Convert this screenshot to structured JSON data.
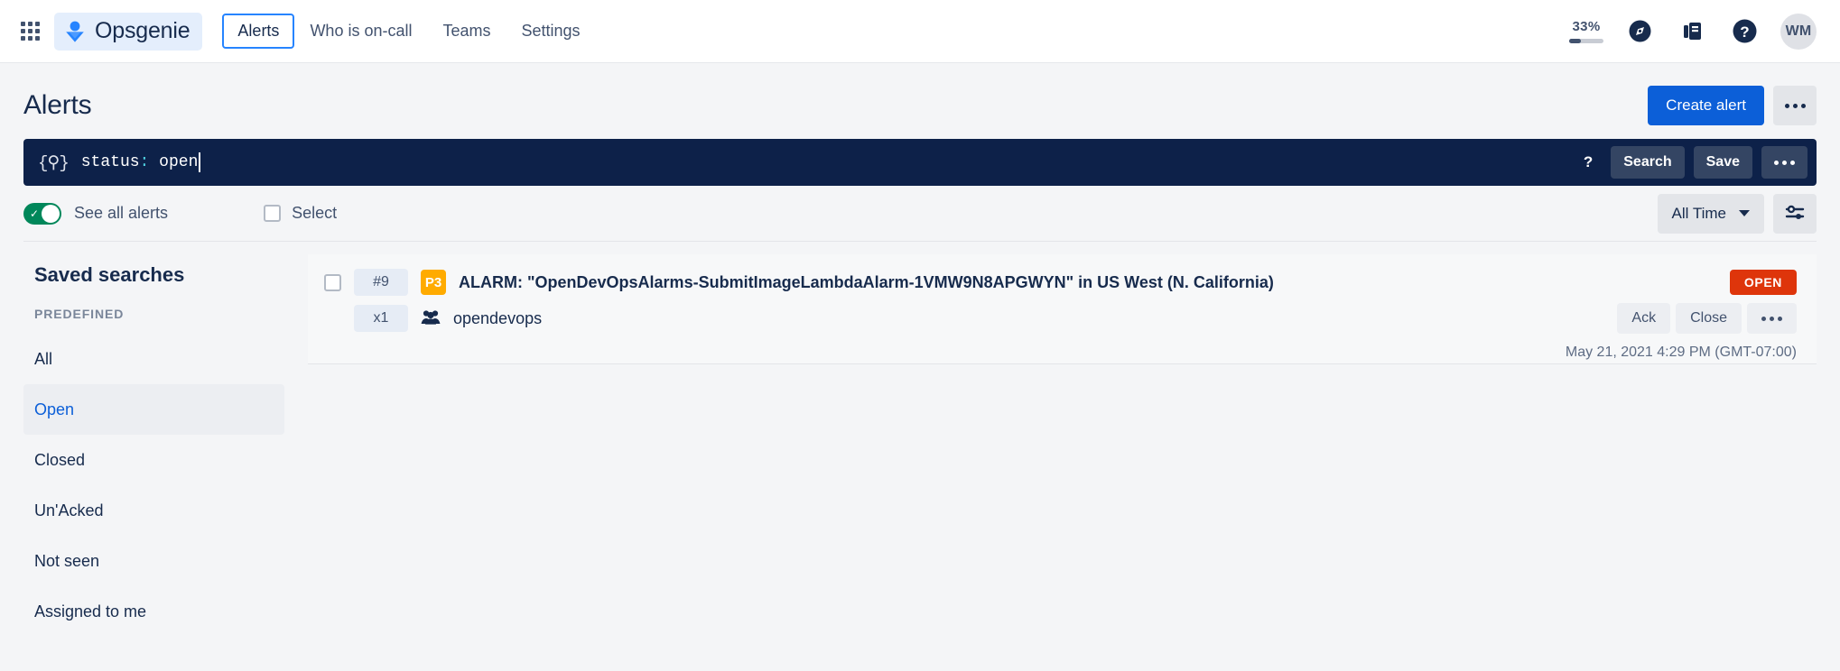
{
  "topnav": {
    "app_switcher_icon": "grid-apps-icon",
    "brand": {
      "name": "Opsgenie",
      "logo_icon": "opsgenie-logo-icon"
    },
    "links": [
      {
        "label": "Alerts",
        "active": true
      },
      {
        "label": "Who is on-call",
        "active": false
      },
      {
        "label": "Teams",
        "active": false
      },
      {
        "label": "Settings",
        "active": false
      }
    ],
    "trial": {
      "percent_label": "33%",
      "percent_value": 33
    },
    "icons": [
      {
        "name": "compass-discover-icon"
      },
      {
        "name": "notebook-icon"
      },
      {
        "name": "help-icon"
      }
    ],
    "avatar": {
      "initials": "WM"
    }
  },
  "page": {
    "title": "Alerts",
    "create_alert_label": "Create alert",
    "more_actions_icon": "ellipsis-icon"
  },
  "search": {
    "query_icon": "query-braces-icon",
    "query_prefix": "status",
    "query_colon": ":",
    "query_value": " open",
    "help_label": "?",
    "search_label": "Search",
    "save_label": "Save",
    "more_icon": "ellipsis-icon"
  },
  "toolbar": {
    "see_all_alerts_label": "See all alerts",
    "see_all_alerts_on": true,
    "select_label": "Select",
    "select_checked": false,
    "time_filter_label": "All Time",
    "filter_icon": "sliders-filter-icon"
  },
  "sidebar": {
    "title": "Saved searches",
    "group_label": "PREDEFINED",
    "items": [
      {
        "label": "All",
        "active": false
      },
      {
        "label": "Open",
        "active": true
      },
      {
        "label": "Closed",
        "active": false
      },
      {
        "label": "Un'Acked",
        "active": false
      },
      {
        "label": "Not seen",
        "active": false
      },
      {
        "label": "Assigned to me",
        "active": false
      }
    ]
  },
  "alerts": [
    {
      "id_chip": "#9",
      "count_chip": "x1",
      "priority": "P3",
      "priority_color": "#ffab00",
      "title": "ALARM: \"OpenDevOpsAlarms-SubmitImageLambdaAlarm-1VMW9N8APGWYN\" in US West (N. California)",
      "team": "opendevops",
      "team_icon": "people-group-icon",
      "status": "OPEN",
      "status_color": "#de350b",
      "actions": {
        "ack_label": "Ack",
        "close_label": "Close",
        "more_icon": "ellipsis-icon"
      },
      "timestamp": "May 21, 2021 4:29 PM (GMT-07:00)"
    }
  ]
}
